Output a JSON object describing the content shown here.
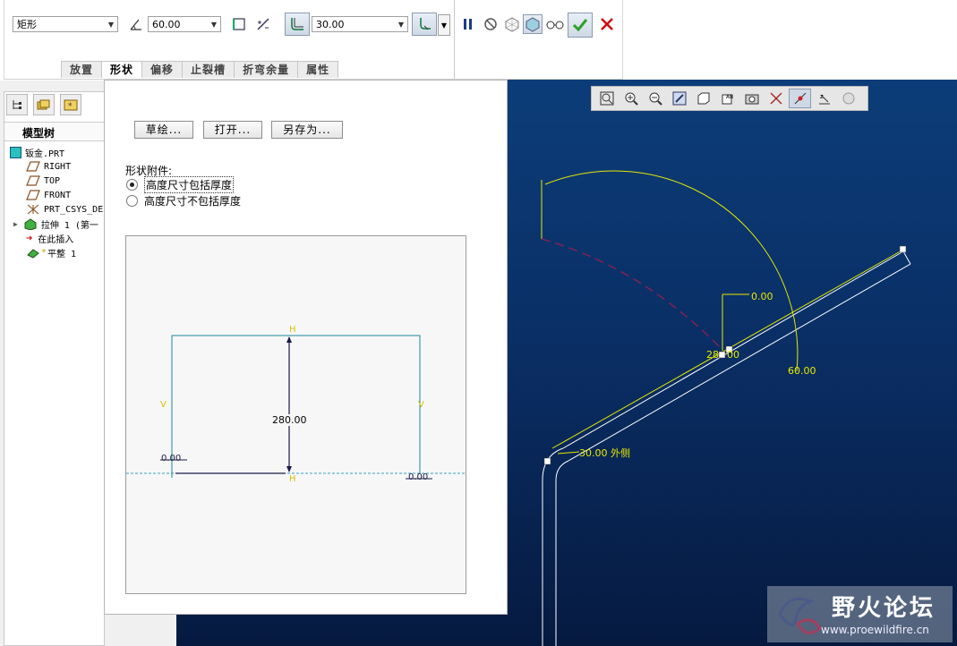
{
  "dashboard": {
    "profile_type": "矩形",
    "angle_value": "60.00",
    "radius_value": "30.00",
    "tabs": [
      {
        "label": "放置",
        "active": false
      },
      {
        "label": "形状",
        "active": true
      },
      {
        "label": "偏移",
        "active": false
      },
      {
        "label": "止裂槽",
        "active": false
      },
      {
        "label": "折弯余量",
        "active": false
      },
      {
        "label": "属性",
        "active": false
      }
    ],
    "icons": [
      "angle-icon",
      "edge-placement-icon",
      "flip-side-icon",
      "bend-radius-icon",
      "pause-icon",
      "no-preview-icon",
      "mesh-preview-icon",
      "shaded-preview-icon",
      "glasses-verify-icon",
      "confirm-check-icon",
      "cancel-x-icon"
    ]
  },
  "model_tree": {
    "title": "模型树",
    "items": [
      {
        "label": "钣金.PRT",
        "icon": "part-icon",
        "indent": 0
      },
      {
        "label": "RIGHT",
        "icon": "datum-plane-icon",
        "indent": 1
      },
      {
        "label": "TOP",
        "icon": "datum-plane-icon",
        "indent": 1
      },
      {
        "label": "FRONT",
        "icon": "datum-plane-icon",
        "indent": 1
      },
      {
        "label": "PRT_CSYS_DEF",
        "icon": "csys-icon",
        "indent": 1
      },
      {
        "label": "拉伸 1 (第一",
        "icon": "extrude-icon",
        "indent": 1
      },
      {
        "label": "在此插入",
        "icon": "insert-arrow-icon",
        "indent": 1
      },
      {
        "label": "平整 1",
        "icon": "flat-wall-icon",
        "indent": 1
      }
    ]
  },
  "shape_panel": {
    "buttons": {
      "sketch": "草绘...",
      "open": "打开...",
      "save_as": "另存为..."
    },
    "attach_label": "形状附件:",
    "options": [
      {
        "label": "高度尺寸包括厚度",
        "selected": true
      },
      {
        "label": "高度尺寸不包括厚度",
        "selected": false
      }
    ],
    "preview": {
      "height_dim": "280.00",
      "left_dim": "0.00",
      "right_dim": "0.00",
      "h_marker": "H",
      "v_marker": "V"
    }
  },
  "viewport": {
    "dim_offset": "0.00",
    "dim_height": "28",
    "dim_height_suffix": "00",
    "dim_angle": "60.00",
    "dim_radius": "30.00 外侧"
  },
  "watermark": {
    "text": "野火论坛",
    "url": "www.proewildfire.cn"
  },
  "colors": {
    "accent_yellow": "#e8e800",
    "viewport_top": "#0c3d78",
    "viewport_bottom": "#061a40",
    "confirm_green": "#2da02d",
    "cancel_red": "#cc1010"
  }
}
